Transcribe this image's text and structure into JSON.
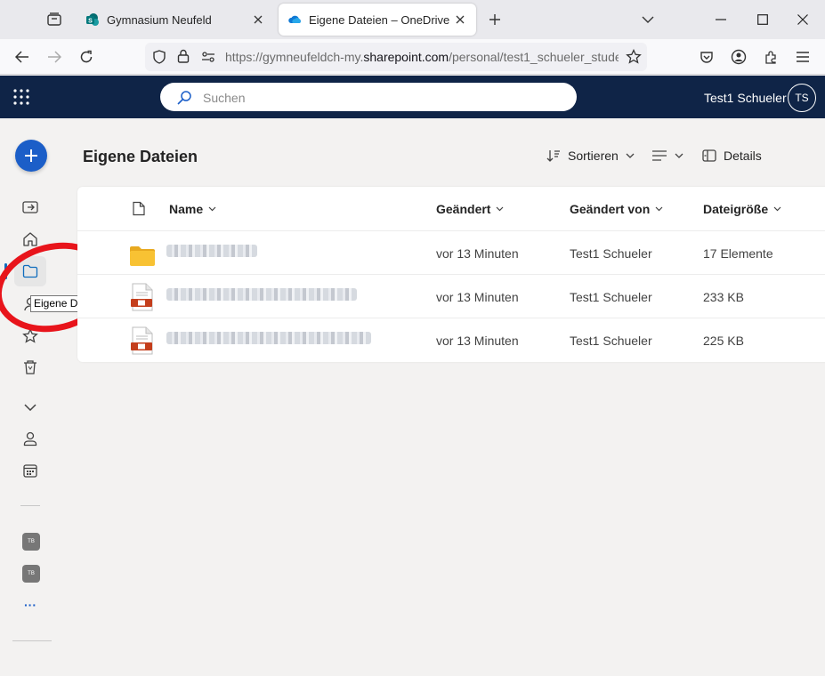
{
  "browser": {
    "tabs": [
      {
        "title": "Gymnasium Neufeld",
        "active": false
      },
      {
        "title": "Eigene Dateien – OneDrive",
        "active": true
      }
    ],
    "url_prefix": "https://gymneufeldch-my.",
    "url_domain": "sharepoint.com",
    "url_path": "/personal/test1_schueler_stude"
  },
  "appbar": {
    "search_placeholder": "Suchen",
    "user_name": "Test1 Schueler",
    "user_initials": "TS",
    "color": "#0f2447"
  },
  "rail": {
    "tooltip": "Eigene Dateien",
    "badge1": "TB",
    "badge2": "TB",
    "more": "···"
  },
  "main": {
    "title": "Eigene Dateien",
    "sort_label": "Sortieren",
    "details_label": "Details"
  },
  "table": {
    "columns": {
      "name": "Name",
      "modified": "Geändert",
      "modified_by": "Geändert von",
      "size": "Dateigröße"
    },
    "rows": [
      {
        "type": "folder-icon",
        "modified": "vor 13 Minuten",
        "modified_by": "Test1 Schueler",
        "size": "17 Elemente"
      },
      {
        "type": "pdf-file-icon",
        "modified": "vor 13 Minuten",
        "modified_by": "Test1 Schueler",
        "size": "233 KB"
      },
      {
        "type": "pdf-file-icon",
        "modified": "vor 13 Minuten",
        "modified_by": "Test1 Schueler",
        "size": "225 KB"
      }
    ]
  },
  "colors": {
    "accent": "#1b5ec8",
    "highlight_circle": "#e8141b",
    "folder": "#f8c233"
  }
}
